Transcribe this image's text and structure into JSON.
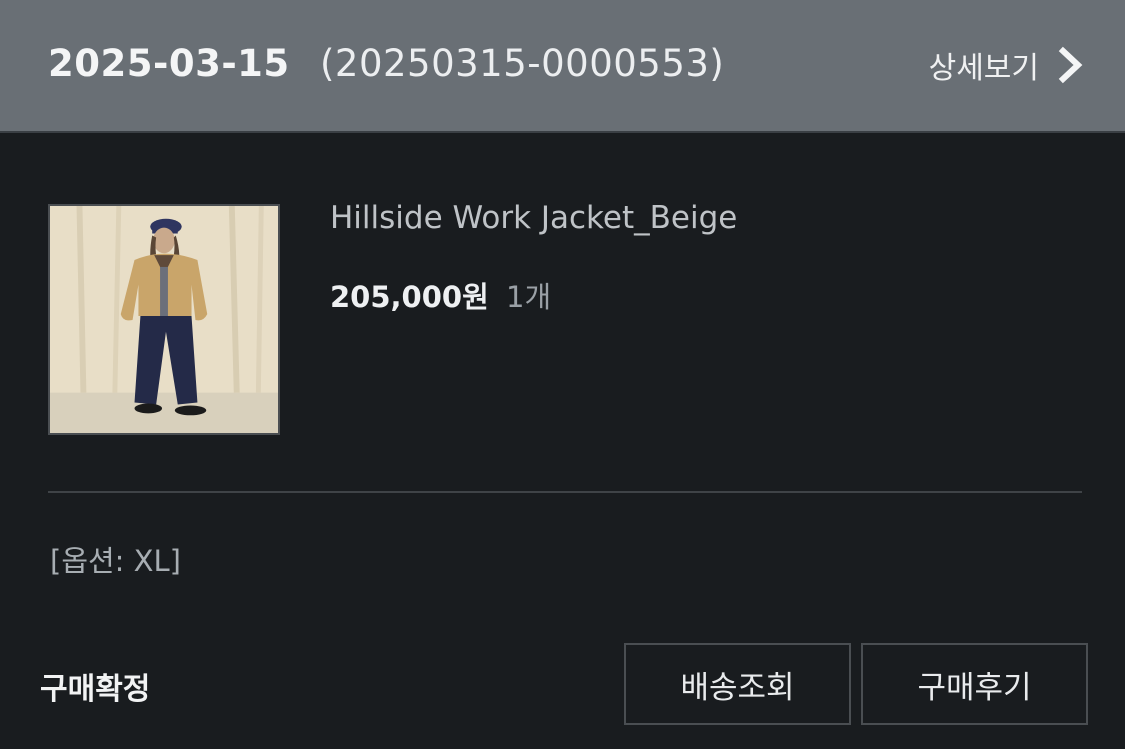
{
  "order": {
    "date": "2025-03-15",
    "number": "(20250315-0000553)",
    "detail_label": "상세보기"
  },
  "product": {
    "name": "Hillside Work Jacket_Beige",
    "price": "205,000원",
    "quantity": "1개",
    "option": "[옵션: XL]",
    "image_alt": "product-photo"
  },
  "status": {
    "label": "구매확정"
  },
  "actions": {
    "shipping_label": "배송조회",
    "review_label": "구매후기"
  },
  "icons": {
    "detail_chevron": "chevron-right-icon"
  },
  "colors": {
    "header_bg": "#696f75",
    "body_bg": "#191c1f",
    "divider": "#3f4347"
  }
}
